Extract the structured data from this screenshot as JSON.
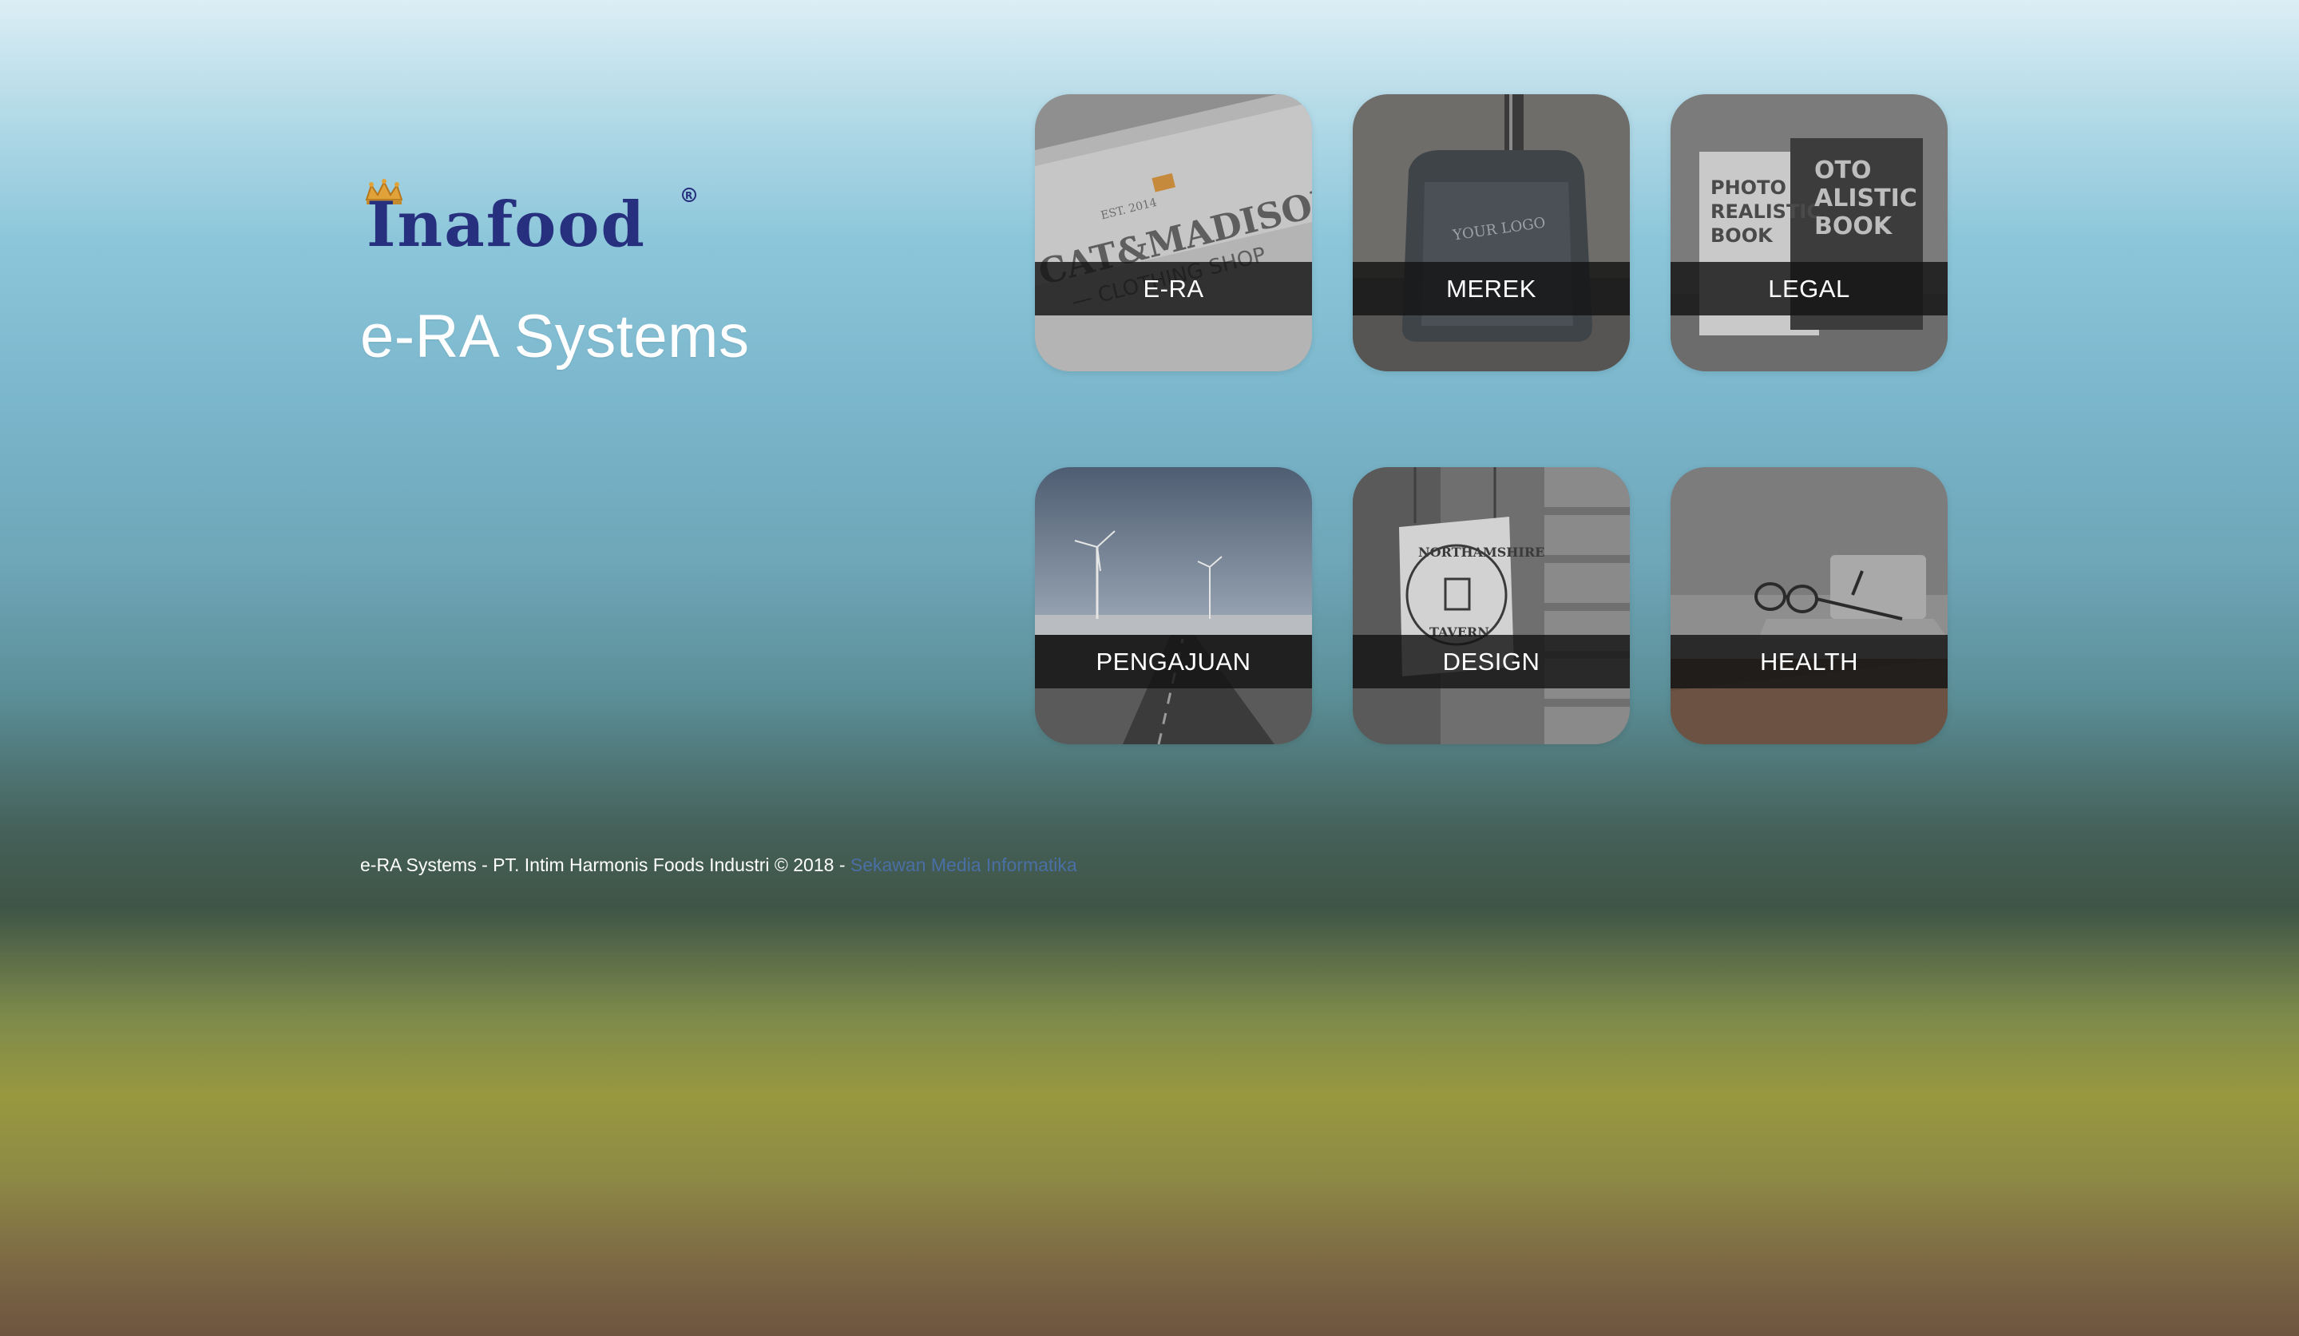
{
  "brand": {
    "logo_text": "Inafood",
    "app_title": "e-RA Systems"
  },
  "tiles": [
    {
      "label": "E-RA",
      "icon": "cat-madison-clothing-shop-mockup-image"
    },
    {
      "label": "MEREK",
      "icon": "logo-bottle-mockup-image"
    },
    {
      "label": "LEGAL",
      "icon": "photo-realistic-book-mockup-image"
    },
    {
      "label": "PENGAJUAN",
      "icon": "wind-turbine-road-image"
    },
    {
      "label": "DESIGN",
      "icon": "northamshire-tavern-sign-image"
    },
    {
      "label": "HEALTH",
      "icon": "glasses-on-desk-image"
    }
  ],
  "footer": {
    "text": "e-RA Systems - PT. Intim Harmonis Foods Industri © 2018 - ",
    "link_label": "Sekawan Media Informatika"
  }
}
